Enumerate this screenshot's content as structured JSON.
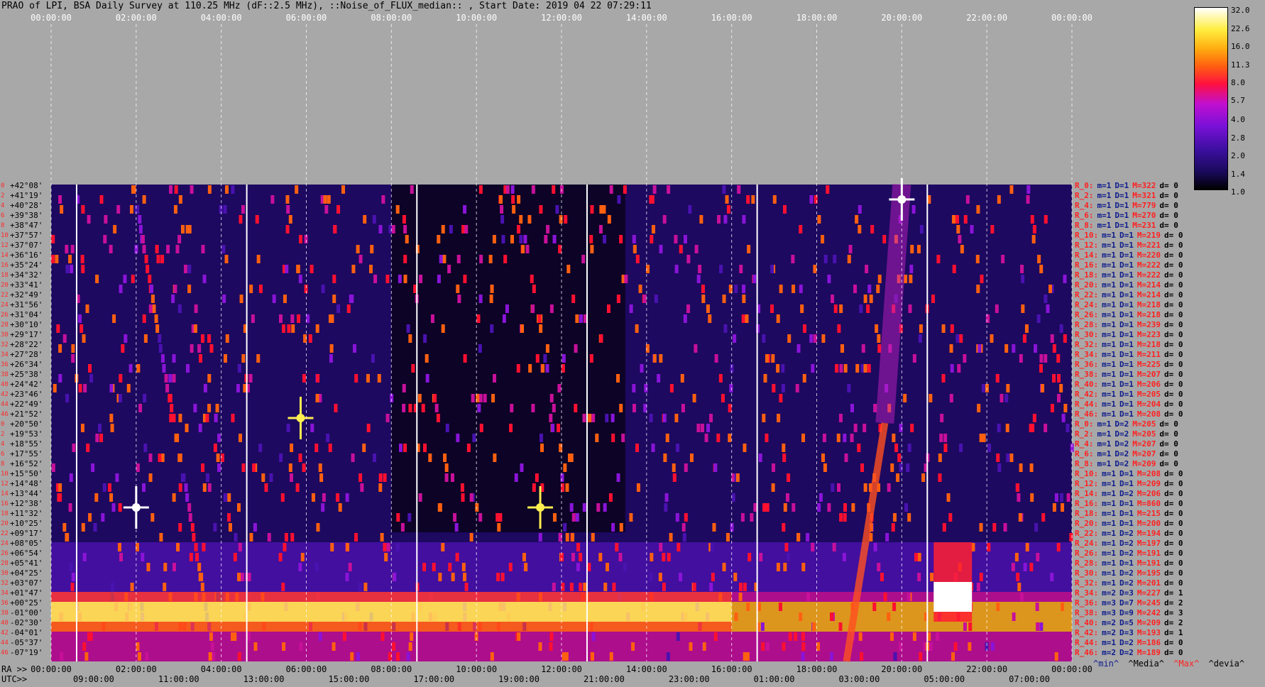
{
  "title": "PRAO of LPI, BSA Daily Survey at 110.25 MHz (dF::2.5 MHz), ::Noise_of_FLUX_median:: , Start Date: 2019 04 22 07:29:11",
  "chart_data": {
    "type": "heatmap",
    "top_ticks": [
      "00:00:00",
      "02:00:00",
      "04:00:00",
      "06:00:00",
      "08:00:00",
      "10:00:00",
      "12:00:00",
      "14:00:00",
      "16:00:00",
      "18:00:00",
      "20:00:00",
      "22:00:00",
      "00:00:00"
    ],
    "ra_label": "RA >>",
    "ra_ticks": [
      "00:00:00",
      "02:00:00",
      "04:00:00",
      "06:00:00",
      "08:00:00",
      "10:00:00",
      "12:00:00",
      "14:00:00",
      "16:00:00",
      "18:00:00",
      "20:00:00",
      "22:00:00",
      "00:00:00"
    ],
    "utc_label": "UTC>>",
    "utc_ticks": [
      "09:00:00",
      "11:00:00",
      "13:00:00",
      "15:00:00",
      "17:00:00",
      "19:00:00",
      "21:00:00",
      "23:00:00",
      "01:00:00",
      "03:00:00",
      "05:00:00",
      "07:00:00"
    ],
    "declinations": [
      "+42°08'",
      "+41°19'",
      "+40°28'",
      "+39°38'",
      "+38°47'",
      "+37°57'",
      "+37°07'",
      "+36°16'",
      "+35°24'",
      "+34°32'",
      "+33°41'",
      "+32°49'",
      "+31°56'",
      "+31°04'",
      "+30°10'",
      "+29°17'",
      "+28°22'",
      "+27°28'",
      "+26°34'",
      "+25°38'",
      "+24°42'",
      "+23°46'",
      "+22°49'",
      "+21°52'",
      "+20°50'",
      "+19°53'",
      "+18°55'",
      "+17°55'",
      "+16°52'",
      "+15°50'",
      "+14°48'",
      "+13°44'",
      "+12°38'",
      "+11°32'",
      "+10°25'",
      "+09°17'",
      "+08°05'",
      "+06°54'",
      "+05°41'",
      "+04°25'",
      "+03°07'",
      "+01°47'",
      "+00°25'",
      "-01°00'",
      "-02°30'",
      "-04°01'",
      "-05°37'",
      "-07°19'"
    ],
    "row_indices": [
      "0",
      "2",
      "4",
      "6",
      "8",
      "10",
      "12",
      "14",
      "16",
      "18",
      "20",
      "22",
      "24",
      "26",
      "28",
      "30",
      "32",
      "34",
      "36",
      "38",
      "40",
      "42",
      "44",
      "46",
      "0",
      "2",
      "4",
      "6",
      "8",
      "10",
      "12",
      "14",
      "16",
      "18",
      "20",
      "22",
      "24",
      "26",
      "28",
      "30",
      "32",
      "34",
      "36",
      "38",
      "40",
      "42",
      "44",
      "46"
    ],
    "colorbar": {
      "ticks": [
        "32.0",
        "22.6",
        "16.0",
        "11.3",
        "8.0",
        "5.7",
        "4.0",
        "2.8",
        "2.0",
        "1.4",
        "1.0"
      ],
      "scale": "log",
      "range": [
        1.0,
        32.0
      ]
    },
    "row_stats": [
      {
        "r": "R_0:",
        "m": "m=1",
        "d": "D=1",
        "M": "M=322",
        "dv": "d= 0"
      },
      {
        "r": "R_2:",
        "m": "m=1",
        "d": "D=1",
        "M": "M=321",
        "dv": "d= 0"
      },
      {
        "r": "R_4:",
        "m": "m=1",
        "d": "D=1",
        "M": "M=779",
        "dv": "d= 0"
      },
      {
        "r": "R_6:",
        "m": "m=1",
        "d": "D=1",
        "M": "M=270",
        "dv": "d= 0"
      },
      {
        "r": "R_8:",
        "m": "m=1",
        "d": "D=1",
        "M": "M=231",
        "dv": "d= 0"
      },
      {
        "r": "R_10:",
        "m": "m=1",
        "d": "D=1",
        "M": "M=219",
        "dv": "d= 0"
      },
      {
        "r": "R_12:",
        "m": "m=1",
        "d": "D=1",
        "M": "M=221",
        "dv": "d= 0"
      },
      {
        "r": "R_14:",
        "m": "m=1",
        "d": "D=1",
        "M": "M=220",
        "dv": "d= 0"
      },
      {
        "r": "R_16:",
        "m": "m=1",
        "d": "D=1",
        "M": "M=222",
        "dv": "d= 0"
      },
      {
        "r": "R_18:",
        "m": "m=1",
        "d": "D=1",
        "M": "M=222",
        "dv": "d= 0"
      },
      {
        "r": "R_20:",
        "m": "m=1",
        "d": "D=1",
        "M": "M=214",
        "dv": "d= 0"
      },
      {
        "r": "R_22:",
        "m": "m=1",
        "d": "D=1",
        "M": "M=214",
        "dv": "d= 0"
      },
      {
        "r": "R_24:",
        "m": "m=1",
        "d": "D=1",
        "M": "M=218",
        "dv": "d= 0"
      },
      {
        "r": "R_26:",
        "m": "m=1",
        "d": "D=1",
        "M": "M=218",
        "dv": "d= 0"
      },
      {
        "r": "R_28:",
        "m": "m=1",
        "d": "D=1",
        "M": "M=239",
        "dv": "d= 0"
      },
      {
        "r": "R_30:",
        "m": "m=1",
        "d": "D=1",
        "M": "M=223",
        "dv": "d= 0"
      },
      {
        "r": "R_32:",
        "m": "m=1",
        "d": "D=1",
        "M": "M=218",
        "dv": "d= 0"
      },
      {
        "r": "R_34:",
        "m": "m=1",
        "d": "D=1",
        "M": "M=211",
        "dv": "d= 0"
      },
      {
        "r": "R_36:",
        "m": "m=1",
        "d": "D=1",
        "M": "M=225",
        "dv": "d= 0"
      },
      {
        "r": "R_38:",
        "m": "m=1",
        "d": "D=1",
        "M": "M=207",
        "dv": "d= 0"
      },
      {
        "r": "R_40:",
        "m": "m=1",
        "d": "D=1",
        "M": "M=206",
        "dv": "d= 0"
      },
      {
        "r": "R_42:",
        "m": "m=1",
        "d": "D=1",
        "M": "M=205",
        "dv": "d= 0"
      },
      {
        "r": "R_44:",
        "m": "m=1",
        "d": "D=1",
        "M": "M=204",
        "dv": "d= 0"
      },
      {
        "r": "R_46:",
        "m": "m=1",
        "d": "D=1",
        "M": "M=208",
        "dv": "d= 0"
      },
      {
        "r": "R_0:",
        "m": "m=1",
        "d": "D=2",
        "M": "M=205",
        "dv": "d= 0"
      },
      {
        "r": "R_2:",
        "m": "m=1",
        "d": "D=2",
        "M": "M=205",
        "dv": "d= 0"
      },
      {
        "r": "R_4:",
        "m": "m=1",
        "d": "D=2",
        "M": "M=207",
        "dv": "d= 0"
      },
      {
        "r": "R_6:",
        "m": "m=1",
        "d": "D=2",
        "M": "M=207",
        "dv": "d= 0"
      },
      {
        "r": "R_8:",
        "m": "m=1",
        "d": "D=2",
        "M": "M=209",
        "dv": "d= 0"
      },
      {
        "r": "R_10:",
        "m": "m=1",
        "d": "D=1",
        "M": "M=208",
        "dv": "d= 0"
      },
      {
        "r": "R_12:",
        "m": "m=1",
        "d": "D=1",
        "M": "M=209",
        "dv": "d= 0"
      },
      {
        "r": "R_14:",
        "m": "m=1",
        "d": "D=2",
        "M": "M=206",
        "dv": "d= 0"
      },
      {
        "r": "R_16:",
        "m": "m=1",
        "d": "D=1",
        "M": "M=860",
        "dv": "d= 0"
      },
      {
        "r": "R_18:",
        "m": "m=1",
        "d": "D=1",
        "M": "M=215",
        "dv": "d= 0"
      },
      {
        "r": "R_20:",
        "m": "m=1",
        "d": "D=1",
        "M": "M=200",
        "dv": "d= 0"
      },
      {
        "r": "R_22:",
        "m": "m=1",
        "d": "D=2",
        "M": "M=194",
        "dv": "d= 0"
      },
      {
        "r": "R_24:",
        "m": "m=1",
        "d": "D=2",
        "M": "M=197",
        "dv": "d= 0"
      },
      {
        "r": "R_26:",
        "m": "m=1",
        "d": "D=2",
        "M": "M=191",
        "dv": "d= 0"
      },
      {
        "r": "R_28:",
        "m": "m=1",
        "d": "D=1",
        "M": "M=191",
        "dv": "d= 0"
      },
      {
        "r": "R_30:",
        "m": "m=1",
        "d": "D=2",
        "M": "M=195",
        "dv": "d= 0"
      },
      {
        "r": "R_32:",
        "m": "m=1",
        "d": "D=2",
        "M": "M=201",
        "dv": "d= 0"
      },
      {
        "r": "R_34:",
        "m": "m=2",
        "d": "D=3",
        "M": "M=227",
        "dv": "d= 1"
      },
      {
        "r": "R_36:",
        "m": "m=3",
        "d": "D=7",
        "M": "M=245",
        "dv": "d= 2"
      },
      {
        "r": "R_38:",
        "m": "m=3",
        "d": "D=9",
        "M": "M=242",
        "dv": "d= 3"
      },
      {
        "r": "R_40:",
        "m": "m=2",
        "d": "D=5",
        "M": "M=209",
        "dv": "d= 2"
      },
      {
        "r": "R_42:",
        "m": "m=2",
        "d": "D=3",
        "M": "M=193",
        "dv": "d= 1"
      },
      {
        "r": "R_44:",
        "m": "m=1",
        "d": "D=2",
        "M": "M=186",
        "dv": "d= 0"
      },
      {
        "r": "R_46:",
        "m": "m=2",
        "d": "D=2",
        "M": "M=189",
        "dv": "d= 0"
      }
    ],
    "legend": {
      "min": "^min^",
      "median": "^Media^",
      "max": "^Max^",
      "deviation": "^devia^"
    },
    "sources": [
      {
        "name": "transit",
        "ra": "02:00:00",
        "dec": "+12°38'",
        "strength": 32
      },
      {
        "name": "transit",
        "ra": "20:00:00",
        "dec": "+41°19'",
        "strength": 32
      },
      {
        "name": "transit",
        "ra": "05:52:00",
        "dec": "+21°52'",
        "strength": 16
      },
      {
        "name": "transit",
        "ra": "11:30:00",
        "dec": "+12°38'",
        "strength": 16
      }
    ]
  },
  "colors": {
    "background": "#a8a8a8",
    "plot_bg": "#14063c",
    "red_text": "#ff2020",
    "blue_text": "#0d1b8c",
    "max_label": "#ff2020"
  }
}
